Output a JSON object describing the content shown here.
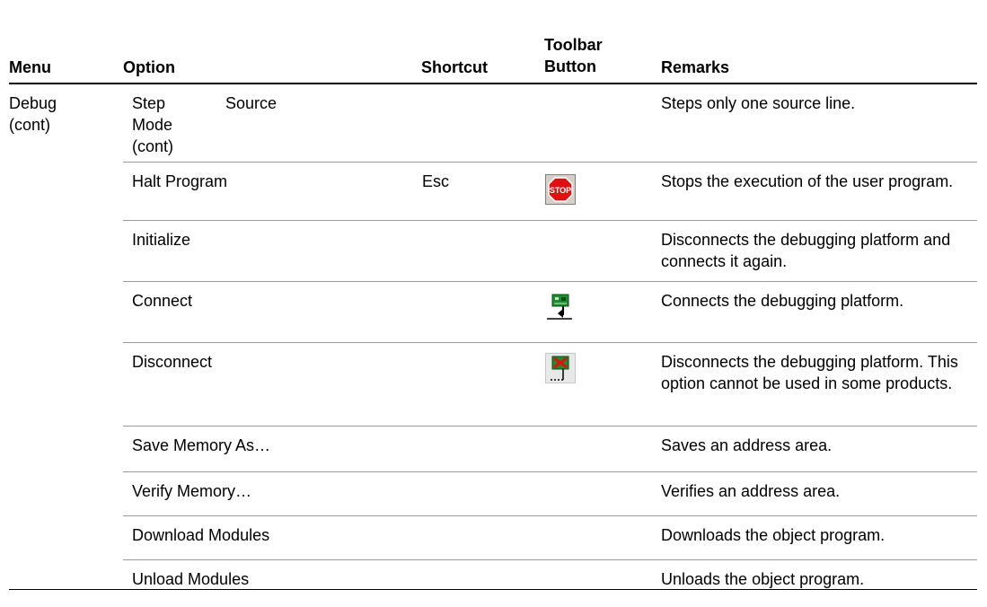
{
  "header": {
    "menu": "Menu",
    "option": "Option",
    "shortcut": "Shortcut",
    "toolbar_line1": "Toolbar",
    "toolbar_line2": "Button",
    "remarks": "Remarks"
  },
  "menu": {
    "line1": "Debug",
    "line2": "(cont)"
  },
  "rows": [
    {
      "option_lines": [
        "Step",
        "Source",
        "Mode",
        "(cont)"
      ],
      "shortcut": "",
      "toolbar_icon": "",
      "remarks": "Steps only one source line."
    },
    {
      "option": "Halt Program",
      "shortcut": "Esc",
      "toolbar_icon": "stop-icon",
      "remarks": "Stops the execution of the user program."
    },
    {
      "option": "Initialize",
      "shortcut": "",
      "toolbar_icon": "",
      "remarks": "Disconnects the debugging platform and connects it again."
    },
    {
      "option": "Connect",
      "shortcut": "",
      "toolbar_icon": "connect-icon",
      "remarks": "Connects the debugging platform."
    },
    {
      "option": "Disconnect",
      "shortcut": "",
      "toolbar_icon": "disconnect-icon",
      "remarks": "Disconnects the debugging platform. This option cannot be used in some products."
    },
    {
      "option": "Save Memory As…",
      "shortcut": "",
      "toolbar_icon": "",
      "remarks": "Saves an address area."
    },
    {
      "option": "Verify Memory…",
      "shortcut": "",
      "toolbar_icon": "",
      "remarks": "Verifies an address area."
    },
    {
      "option": "Download Modules",
      "shortcut": "",
      "toolbar_icon": "",
      "remarks": "Downloads the object program."
    },
    {
      "option": "Unload Modules",
      "shortcut": "",
      "toolbar_icon": "",
      "remarks": "Unloads the object program."
    }
  ],
  "colors": {
    "stop_red": "#e01010",
    "board_green": "#1e8c2e",
    "row_rule": "#9a9a9a"
  }
}
